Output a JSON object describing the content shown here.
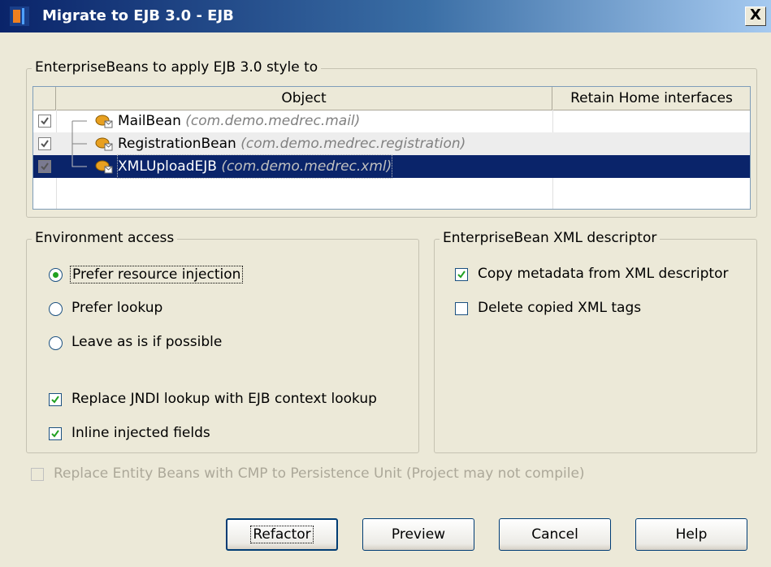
{
  "window": {
    "title": "Migrate to EJB 3.0 - EJB",
    "close_label": "X"
  },
  "beans_group": {
    "legend": "EnterpriseBeans to apply EJB 3.0 style to",
    "columns": [
      "Object",
      "Retain Home interfaces"
    ],
    "rows": [
      {
        "name": "MailBean",
        "package": "(com.demo.medrec.mail)",
        "checked": true,
        "selected": false
      },
      {
        "name": "RegistrationBean",
        "package": "(com.demo.medrec.registration)",
        "checked": true,
        "selected": false
      },
      {
        "name": "XMLUploadEJB",
        "package": "(com.demo.medrec.xml)",
        "checked": true,
        "selected": true
      }
    ]
  },
  "environment": {
    "legend": "Environment access",
    "radios": [
      "Prefer resource injection",
      "Prefer lookup",
      "Leave as is if possible"
    ],
    "selected": "Prefer resource injection",
    "checkboxes": [
      {
        "label": "Replace JNDI lookup with EJB context lookup",
        "checked": true
      },
      {
        "label": "Inline injected fields",
        "checked": true
      }
    ]
  },
  "xml_descriptor": {
    "legend": "EnterpriseBean XML descriptor",
    "checkboxes": [
      {
        "label": "Copy metadata from XML descriptor",
        "checked": true
      },
      {
        "label": "Delete copied XML tags",
        "checked": false
      }
    ]
  },
  "replace_entity": {
    "label": "Replace Entity Beans with CMP to Persistence Unit (Project may not compile)",
    "checked": false,
    "enabled": false
  },
  "buttons": {
    "refactor": "Refactor",
    "preview": "Preview",
    "cancel": "Cancel",
    "help": "Help"
  }
}
